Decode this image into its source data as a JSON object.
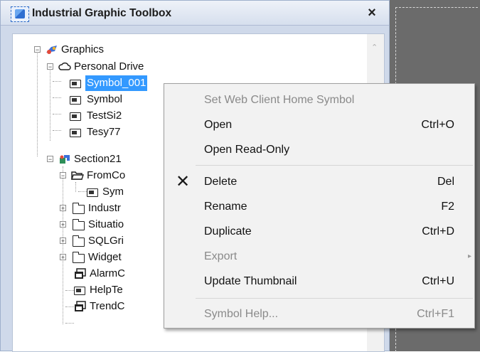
{
  "panel": {
    "title": "Industrial Graphic Toolbox",
    "close_symbol": "×"
  },
  "tree": {
    "nodes": [
      {
        "label": "Graphics",
        "icon": "graphics-library-icon",
        "expander": "−"
      },
      {
        "label": "Personal Drive",
        "icon": "cloud-icon",
        "expander": "−"
      },
      {
        "label": "Symbol_001",
        "icon": "symbol-icon",
        "selected": true
      },
      {
        "label": "Symbol",
        "icon": "symbol-icon"
      },
      {
        "label": "TestSi2",
        "icon": "symbol-icon"
      },
      {
        "label": "Tesy77",
        "icon": "symbol-icon"
      },
      {
        "label": "Section21",
        "icon": "section-icon",
        "expander": "−"
      },
      {
        "label": "FromCo",
        "icon": "open-folder-icon",
        "expander": "−"
      },
      {
        "label": "Sym",
        "icon": "symbol-icon"
      },
      {
        "label": "Industr",
        "icon": "folder-icon",
        "expander": "+"
      },
      {
        "label": "Situatio",
        "icon": "folder-icon",
        "expander": "+"
      },
      {
        "label": "SQLGri",
        "icon": "folder-icon",
        "expander": "+"
      },
      {
        "label": "Widget",
        "icon": "folder-icon",
        "expander": "+"
      },
      {
        "label": "AlarmC",
        "icon": "window-symbol-icon"
      },
      {
        "label": "HelpTe",
        "icon": "symbol-icon"
      },
      {
        "label": "TrendC",
        "icon": "window-symbol-icon"
      }
    ]
  },
  "context_menu": {
    "items": [
      {
        "label": "Set Web Client Home Symbol",
        "shortcut": "",
        "enabled": false
      },
      {
        "label": "Open",
        "shortcut": "Ctrl+O",
        "enabled": true
      },
      {
        "label": "Open Read-Only",
        "shortcut": "",
        "enabled": true
      },
      {
        "label": "Delete",
        "shortcut": "Del",
        "enabled": true,
        "glyph": "✕"
      },
      {
        "label": "Rename",
        "shortcut": "F2",
        "enabled": true
      },
      {
        "label": "Duplicate",
        "shortcut": "Ctrl+D",
        "enabled": true
      },
      {
        "label": "Export",
        "shortcut": "",
        "enabled": false,
        "submenu_arrow": "▸"
      },
      {
        "label": "Update Thumbnail",
        "shortcut": "Ctrl+U",
        "enabled": true
      },
      {
        "label": "Symbol Help...",
        "shortcut": "Ctrl+F1",
        "enabled": false
      }
    ]
  },
  "colors": {
    "selection": "#3399ff",
    "panel_bg": "#cfd9ea",
    "canvas_bg": "#6b6b6b",
    "disabled_text": "#8a8a8a"
  }
}
